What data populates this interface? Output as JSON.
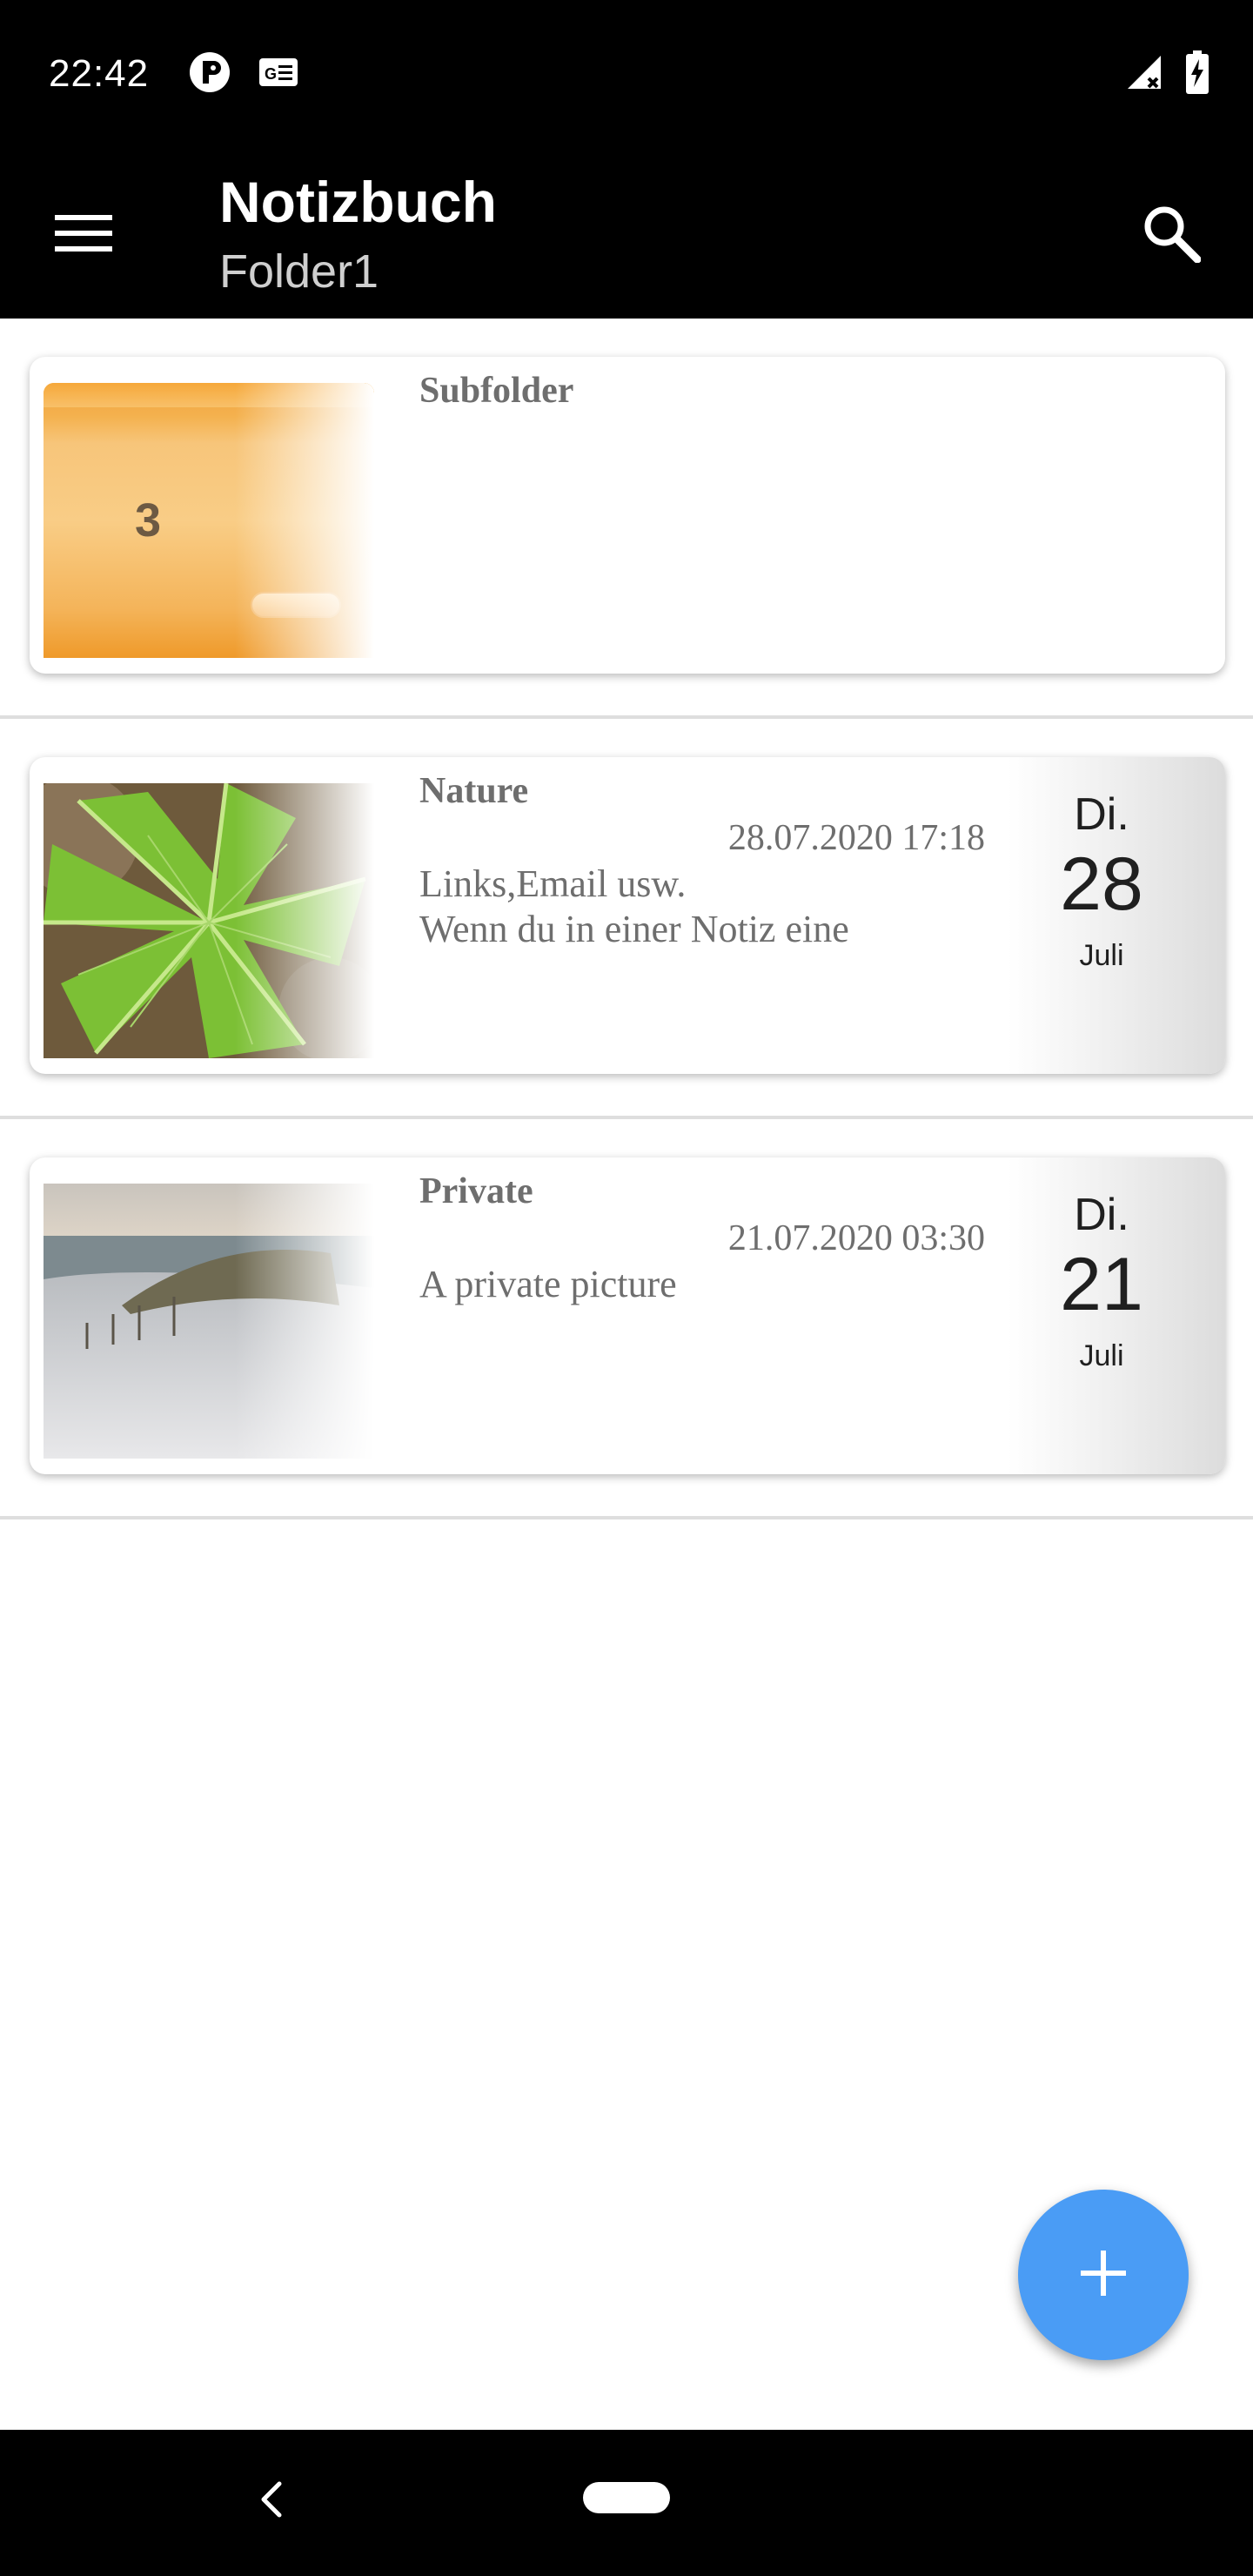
{
  "status_bar": {
    "time": "22:42",
    "left_icons": [
      "app-notification-icon",
      "news-icon"
    ],
    "right_icons": [
      "signal-off-icon",
      "battery-charging-icon"
    ]
  },
  "app_bar": {
    "menu_icon": "hamburger-menu-icon",
    "title": "Notizbuch",
    "subtitle": "Folder1",
    "search_icon": "search-icon"
  },
  "items": [
    {
      "type": "folder",
      "title": "Subfolder",
      "count": "3"
    },
    {
      "type": "note",
      "title": "Nature",
      "datetime": "28.07.2020 17:18",
      "preview_line1": "Links,Email usw.",
      "preview_line2": "Wenn du in einer Notiz eine",
      "dow": "Di.",
      "day": "28",
      "month": "Juli",
      "thumbnail": "green leaf photo"
    },
    {
      "type": "note",
      "title": "Private",
      "datetime": "21.07.2020 03:30",
      "preview_line1": "A private picture",
      "preview_line2": "",
      "dow": "Di.",
      "day": "21",
      "month": "Juli",
      "thumbnail": "beach photo"
    }
  ],
  "fab": {
    "icon": "plus-icon",
    "color": "#4a9cf5"
  },
  "nav_bar": {
    "back_icon": "back-chevron-icon",
    "home_icon": "home-pill-icon"
  }
}
